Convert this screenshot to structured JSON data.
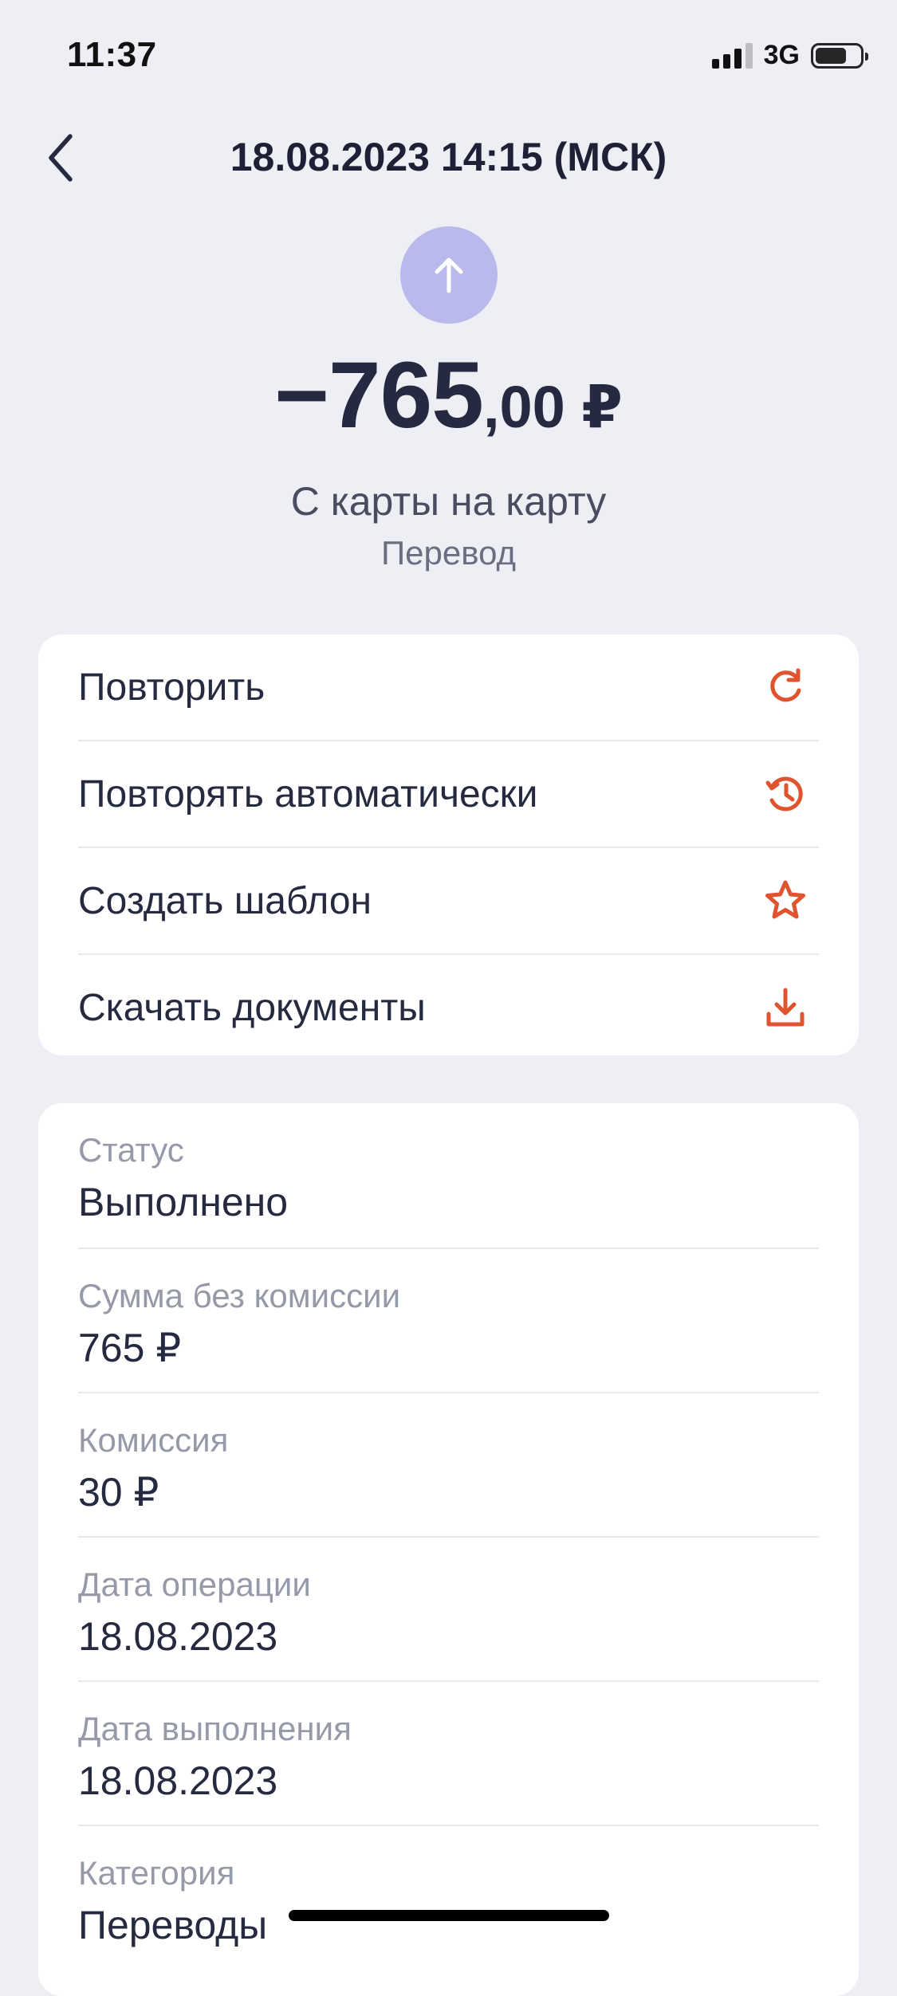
{
  "status_bar": {
    "time": "11:37",
    "network": "3G",
    "signal_bars": 3,
    "battery_level": 0.65
  },
  "header": {
    "back_icon": "chevron-left-icon",
    "title": "18.08.2023 14:15 (МСК)"
  },
  "operation": {
    "icon": "arrow-up-icon",
    "icon_color": "#B9B9EC",
    "amount_main": "−765",
    "amount_fraction": ",00 ₽",
    "title": "С карты на карту",
    "subtitle": "Перевод"
  },
  "actions": [
    {
      "label": "Повторить",
      "icon": "repeat-icon"
    },
    {
      "label": "Повторять автоматически",
      "icon": "history-icon"
    },
    {
      "label": "Создать шаблон",
      "icon": "star-icon"
    },
    {
      "label": "Скачать документы",
      "icon": "download-icon"
    }
  ],
  "accent_color": "#E0532F",
  "details": [
    {
      "label": "Статус",
      "value": "Выполнено"
    },
    {
      "label": "Сумма без комиссии",
      "value": "765 ₽"
    },
    {
      "label": "Комиссия",
      "value": "30 ₽"
    },
    {
      "label": "Дата операции",
      "value": "18.08.2023"
    },
    {
      "label": "Дата выполнения",
      "value": "18.08.2023"
    },
    {
      "label": "Категория",
      "value": "Переводы"
    }
  ]
}
